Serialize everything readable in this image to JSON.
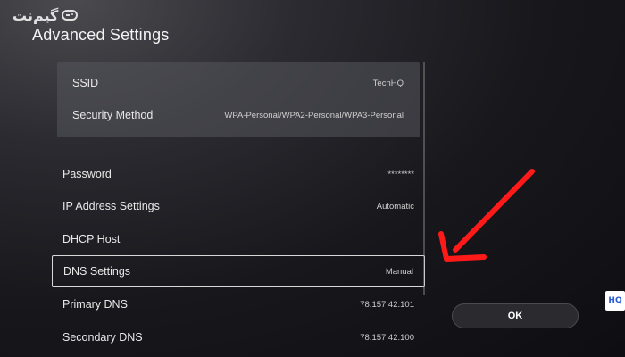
{
  "watermark": {
    "logo_text": "گیم‌نت"
  },
  "header": {
    "title": "Advanced Settings"
  },
  "network_group": [
    {
      "label": "SSID",
      "value": "TechHQ"
    },
    {
      "label": "Security Method",
      "value": "WPA-Personal/WPA2-Personal/WPA3-Personal"
    }
  ],
  "settings": [
    {
      "label": "Password",
      "value": "********"
    },
    {
      "label": "IP Address Settings",
      "value": "Automatic"
    },
    {
      "label": "DHCP Host",
      "value": ""
    },
    {
      "label": "DNS Settings",
      "value": "Manual"
    },
    {
      "label": "Primary DNS",
      "value": "78.157.42.101"
    },
    {
      "label": "Secondary DNS",
      "value": "78.157.42.100"
    }
  ],
  "actions": {
    "ok_label": "OK"
  },
  "badge": {
    "text": "HQ"
  },
  "colors": {
    "arrow": "#ff1a1a",
    "selection_border": "#d8d8d8"
  },
  "icons": {
    "logo": "gamepad-icon",
    "annotation": "red-arrow-icon"
  }
}
